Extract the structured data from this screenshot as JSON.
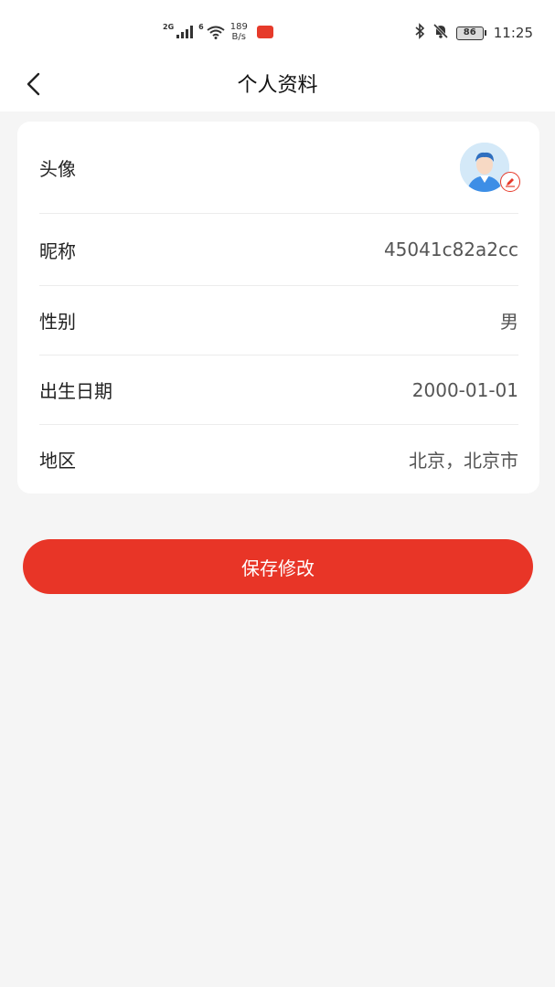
{
  "status_bar": {
    "net_left": "2G",
    "net_right": "6",
    "speed_value": "189",
    "speed_unit": "B/s",
    "battery": "86",
    "time": "11:25",
    "icons": [
      "signal-icon",
      "wifi-icon",
      "app-notification-icon",
      "bluetooth-icon",
      "mute-bell-icon",
      "battery-icon"
    ]
  },
  "header": {
    "title": "个人资料",
    "back_icon": "chevron-left-icon"
  },
  "profile": {
    "avatar_label": "头像",
    "nickname_label": "昵称",
    "nickname_value": "45041c82a2cc",
    "gender_label": "性别",
    "gender_value": "男",
    "birthday_label": "出生日期",
    "birthday_value": "2000-01-01",
    "region_label": "地区",
    "region_value": "北京，北京市"
  },
  "actions": {
    "save_label": "保存修改"
  },
  "colors": {
    "accent": "#e83527",
    "background": "#f5f5f5",
    "card": "#ffffff"
  }
}
